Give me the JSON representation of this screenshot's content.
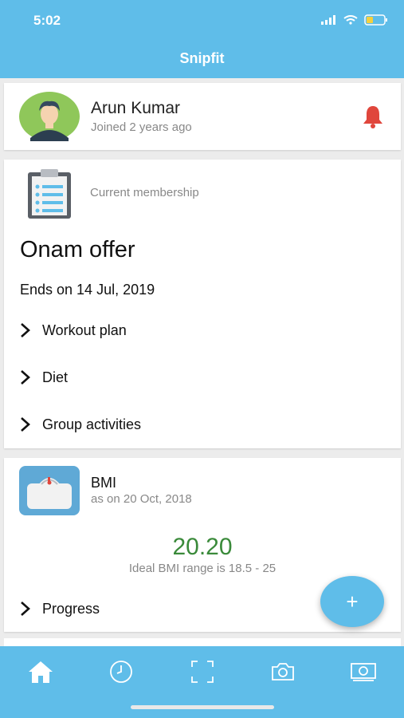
{
  "status": {
    "time": "5:02"
  },
  "header": {
    "title": "Snipfit"
  },
  "profile": {
    "name": "Arun Kumar",
    "joined": "Joined 2 years ago"
  },
  "membership": {
    "label": "Current membership",
    "offer": "Onam offer",
    "ends": "Ends on 14 Jul, 2019",
    "items": [
      {
        "label": "Workout plan"
      },
      {
        "label": "Diet"
      },
      {
        "label": "Group activities"
      }
    ]
  },
  "bmi": {
    "title": "BMI",
    "date": "as on 20 Oct, 2018",
    "value": "20.20",
    "range": "Ideal BMI range is 18.5 - 25",
    "progress_label": "Progress"
  },
  "fab": {
    "label": "+"
  },
  "nav": {
    "items": [
      {
        "icon": "home-icon"
      },
      {
        "icon": "clock-icon"
      },
      {
        "icon": "scan-icon"
      },
      {
        "icon": "camera-icon"
      },
      {
        "icon": "money-icon"
      }
    ]
  },
  "colors": {
    "primary": "#5fbde9",
    "bmi_value": "#3a8a3a",
    "bell": "#e0463c"
  }
}
